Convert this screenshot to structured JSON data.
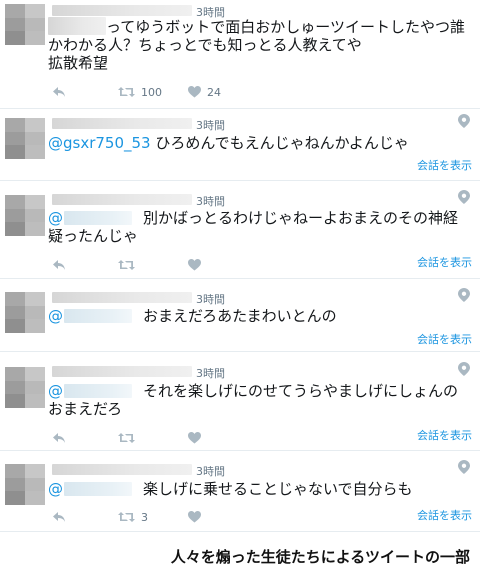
{
  "tweets": [
    {
      "time": "3時間",
      "text": "ってゆうボットで面白おかしゅーツイートしたやつ誰かわかる人？ちょっとでも知っとる人教えてや\n拡散希望",
      "retweets": "100",
      "likes": "24",
      "show_conversation": ""
    },
    {
      "time": "3時間",
      "mention": "@gsxr750_53",
      "text": " ひろめんでもえんじゃねんかよんじゃ",
      "retweets": "",
      "likes": "",
      "show_conversation": "会話を表示"
    },
    {
      "time": "3時間",
      "mention": "@",
      "text": "別かばっとるわけじゃねーよおまえのその神経疑ったんじゃ",
      "retweets": "",
      "likes": "",
      "show_conversation": "会話を表示"
    },
    {
      "time": "3時間",
      "mention": "@",
      "text": "おまえだろあたまわいとんの",
      "retweets": "",
      "likes": "",
      "show_conversation": "会話を表示"
    },
    {
      "time": "3時間",
      "mention": "@",
      "text": "それを楽しげにのせてうらやましげにしょんのおまえだろ",
      "retweets": "",
      "likes": "",
      "show_conversation": "会話を表示"
    },
    {
      "time": "3時間",
      "mention": "@",
      "text": "楽しげに乗せることじゃないで自分らも",
      "retweets": "3",
      "likes": "",
      "show_conversation": "会話を表示"
    }
  ],
  "caption": "人々を煽った生徒たちによるツイートの一部",
  "colors": {
    "mention": "#1b95e0",
    "muted": "#657786",
    "text": "#14171a"
  },
  "icons": [
    "reply-icon",
    "retweet-icon",
    "like-icon",
    "location-pin-icon"
  ]
}
